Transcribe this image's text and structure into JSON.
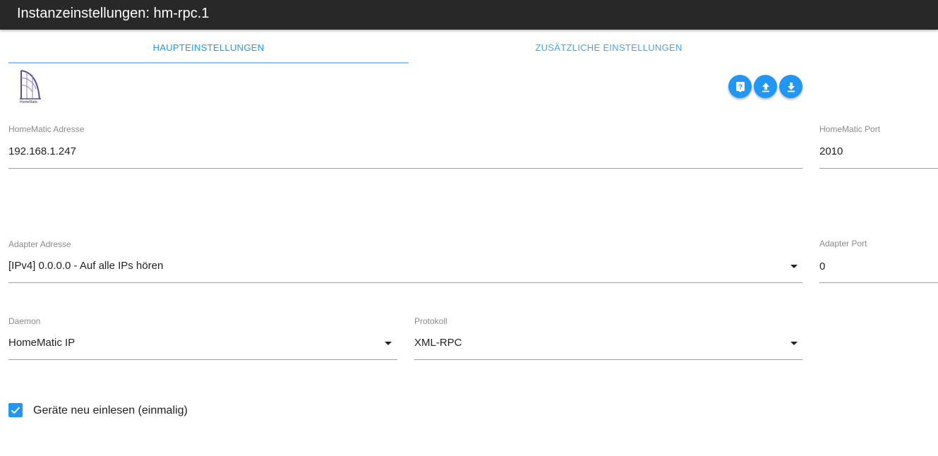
{
  "window": {
    "title": "Instanzeinstellungen: hm-rpc.1"
  },
  "tabs": [
    {
      "label": "HAUPTEINSTELLUNGEN",
      "active": true
    },
    {
      "label": "ZUSÄTZLICHE EINSTELLUNGEN",
      "active": false
    }
  ],
  "logo": {
    "text": "HomeMatic"
  },
  "actions": [
    {
      "icon": "help-icon"
    },
    {
      "icon": "upload-icon"
    },
    {
      "icon": "download-icon"
    }
  ],
  "fields": {
    "homematic_address": {
      "label": "HomeMatic Adresse",
      "value": "192.168.1.247"
    },
    "homematic_port": {
      "label": "HomeMatic Port",
      "value": "2010"
    },
    "adapter_address": {
      "label": "Adapter Adresse",
      "value": "[IPv4] 0.0.0.0 - Auf alle IPs hören"
    },
    "adapter_port": {
      "label": "Adapter Port",
      "value": "0"
    },
    "daemon": {
      "label": "Daemon",
      "value": "HomeMatic IP"
    },
    "protocol": {
      "label": "Protokoll",
      "value": "XML-RPC"
    }
  },
  "reread_devices": {
    "label": "Geräte neu einlesen (einmalig)",
    "checked": true
  },
  "colors": {
    "accent": "#2196f3",
    "titlebar": "#282828"
  }
}
